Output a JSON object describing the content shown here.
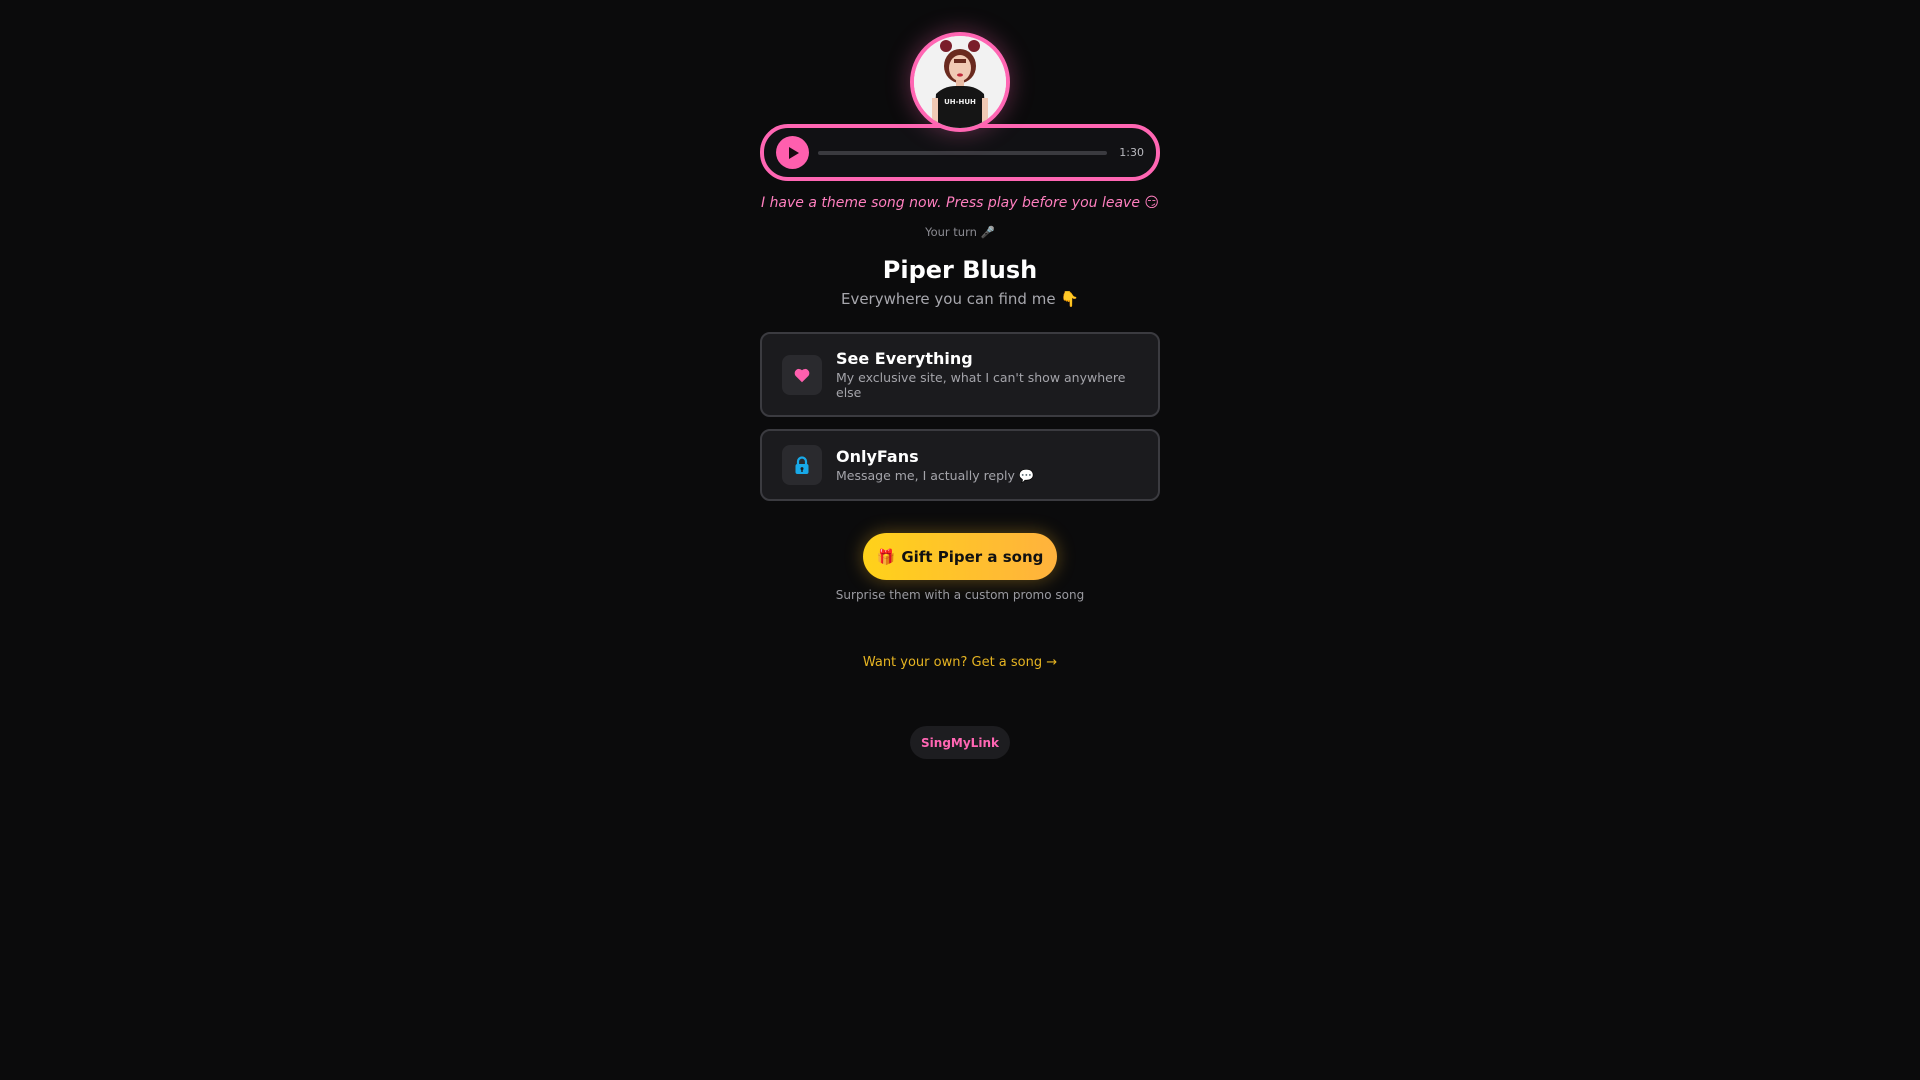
{
  "player": {
    "duration": "1:30",
    "progress": 0
  },
  "profile": {
    "tagline": "I have a theme song now. Press play before you leave 😏",
    "your_turn": "Your turn 🎤",
    "name": "Piper Blush",
    "subtitle": "Everywhere you can find me 👇",
    "avatar_icon": "profile-photo"
  },
  "links": [
    {
      "title": "See Everything",
      "description": "My exclusive site, what I can't show anywhere else",
      "icon": "heart-icon",
      "icon_color": "#ff5fae"
    },
    {
      "title": "OnlyFans",
      "description": "Message me, I actually reply 💬",
      "icon": "lock-icon",
      "icon_color": "#18a9e8"
    }
  ],
  "gift": {
    "label": "Gift Piper a song",
    "icon": "🎁",
    "subtext": "Surprise them with a custom promo song"
  },
  "cta": {
    "get_song": "Want your own? Get a song →"
  },
  "brand": {
    "label": "SingMyLink"
  },
  "colors": {
    "accent": "#ff66b3",
    "gold": "#ffc62a",
    "background": "#0b0b0c"
  }
}
